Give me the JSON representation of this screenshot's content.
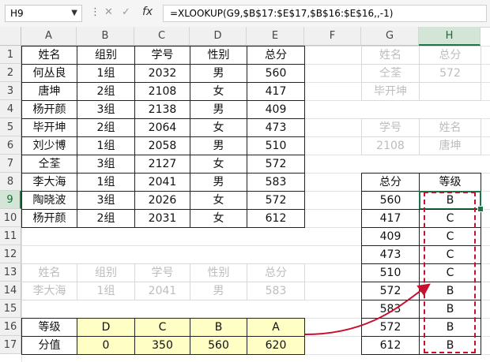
{
  "name_box": "H9",
  "formula": "=XLOOKUP(G9,$B$17:$E$17,$B$16:$E$16,,-1)",
  "icons": {
    "cancel": "close-icon",
    "enter": "check-icon",
    "function": "fx-icon"
  },
  "fx_label": "fx",
  "columns": [
    "A",
    "B",
    "C",
    "D",
    "E",
    "F",
    "G",
    "H"
  ],
  "rows": [
    "1",
    "2",
    "3",
    "4",
    "5",
    "6",
    "7",
    "8",
    "9",
    "10",
    "11",
    "12",
    "13",
    "14",
    "15",
    "16",
    "17"
  ],
  "main_table": {
    "headers": [
      "姓名",
      "组别",
      "学号",
      "性别",
      "总分"
    ],
    "rows": [
      [
        "何丛良",
        "1组",
        "2032",
        "男",
        "560"
      ],
      [
        "唐坤",
        "2组",
        "2108",
        "女",
        "417"
      ],
      [
        "杨开颜",
        "3组",
        "2138",
        "男",
        "409"
      ],
      [
        "毕开坤",
        "2组",
        "2064",
        "女",
        "473"
      ],
      [
        "刘少博",
        "1组",
        "2058",
        "男",
        "510"
      ],
      [
        "仝荃",
        "3组",
        "2127",
        "女",
        "572"
      ],
      [
        "李大海",
        "1组",
        "2041",
        "男",
        "583"
      ],
      [
        "陶晓波",
        "3组",
        "2026",
        "女",
        "572"
      ],
      [
        "杨开颜",
        "2组",
        "2031",
        "女",
        "612"
      ]
    ]
  },
  "faded_lookup": {
    "headers": [
      "姓名",
      "组别",
      "学号",
      "性别",
      "总分"
    ],
    "row": [
      "李大海",
      "1组",
      "2041",
      "男",
      "583"
    ]
  },
  "grade_table": {
    "label_grade": "等级",
    "label_value": "分值",
    "grades": [
      "D",
      "C",
      "B",
      "A"
    ],
    "values": [
      "0",
      "350",
      "560",
      "620"
    ]
  },
  "g_faded1": {
    "h1": "姓名",
    "h2": "总分",
    "r1": [
      "仝荃",
      "572"
    ],
    "r2": [
      "毕开坤",
      ""
    ]
  },
  "g_faded2": {
    "h1": "学号",
    "h2": "姓名",
    "r1": [
      "2108",
      "唐坤"
    ]
  },
  "result_table": {
    "header_score": "总分",
    "header_grade": "等级",
    "rows": [
      [
        "560",
        "B"
      ],
      [
        "417",
        "C"
      ],
      [
        "409",
        "C"
      ],
      [
        "473",
        "C"
      ],
      [
        "510",
        "C"
      ],
      [
        "572",
        "B"
      ],
      [
        "583",
        "B"
      ],
      [
        "572",
        "B"
      ],
      [
        "612",
        "B"
      ]
    ]
  },
  "colors": {
    "accent": "#217346",
    "annotation": "#c8102e",
    "highlight": "#ffffc5"
  }
}
